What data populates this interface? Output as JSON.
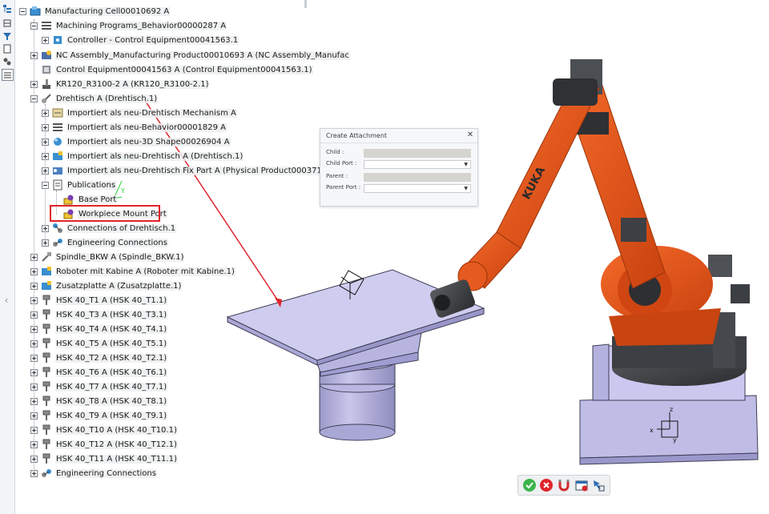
{
  "tree": {
    "items": [
      {
        "label": "Manufacturing Cell00010692 A",
        "icon": "manufacturing-cell-icon"
      },
      {
        "label": "Machining Programs_Behavior00000287 A",
        "icon": "behavior-icon"
      },
      {
        "label": "Controller - Control Equipment00041563.1",
        "icon": "controller-icon"
      },
      {
        "label": "NC Assembly_Manufacturing Product00010693 A (NC Assembly_Manufac",
        "icon": "nc-assembly-icon"
      },
      {
        "label": "Control Equipment00041563 A (Control Equipment00041563.1)",
        "icon": "control-equipment-icon"
      },
      {
        "label": "KR120_R3100-2 A (KR120_R3100-2.1)",
        "icon": "robot-icon"
      },
      {
        "label": "Drehtisch A (Drehtisch.1)",
        "icon": "turntable-icon"
      },
      {
        "label": "Importiert als neu-Drehtisch Mechanism A",
        "icon": "mechanism-icon"
      },
      {
        "label": "Importiert als neu-Behavior00001829 A",
        "icon": "behavior-icon"
      },
      {
        "label": "Importiert als neu-3D Shape00026904 A",
        "icon": "shape-icon"
      },
      {
        "label": "Importiert als neu-Drehtisch A (Drehtisch.1)",
        "icon": "product-icon"
      },
      {
        "label": "Importiert als neu-Drehtisch Fix Part A (Physical Product00037126.1)",
        "icon": "physical-product-icon"
      },
      {
        "label": "Publications",
        "icon": "publications-icon"
      },
      {
        "label": "Base Port",
        "icon": "port-icon"
      },
      {
        "label": "Workpiece Mount Port",
        "icon": "port-icon"
      },
      {
        "label": "Connections of Drehtisch.1",
        "icon": "connections-icon"
      },
      {
        "label": "Engineering Connections",
        "icon": "engineering-connections-icon"
      },
      {
        "label": "Spindle_BKW A (Spindle_BKW.1)",
        "icon": "spindle-icon"
      },
      {
        "label": "Roboter mit Kabine A (Roboter mit Kabine.1)",
        "icon": "product-icon"
      },
      {
        "label": "Zusatzplatte A (Zusatzplatte.1)",
        "icon": "product-icon"
      },
      {
        "label": "HSK 40_T1 A (HSK 40_T1.1)",
        "icon": "tool-icon"
      },
      {
        "label": "HSK 40_T3 A (HSK 40_T3.1)",
        "icon": "tool-icon"
      },
      {
        "label": "HSK 40_T4 A (HSK 40_T4.1)",
        "icon": "tool-icon"
      },
      {
        "label": "HSK 40_T5 A (HSK 40_T5.1)",
        "icon": "tool-icon"
      },
      {
        "label": "HSK 40_T2 A (HSK 40_T2.1)",
        "icon": "tool-icon"
      },
      {
        "label": "HSK 40_T6 A (HSK 40_T6.1)",
        "icon": "tool-icon"
      },
      {
        "label": "HSK 40_T7 A (HSK 40_T7.1)",
        "icon": "tool-icon"
      },
      {
        "label": "HSK 40_T8 A (HSK 40_T8.1)",
        "icon": "tool-icon"
      },
      {
        "label": "HSK 40_T9 A (HSK 40_T9.1)",
        "icon": "tool-icon"
      },
      {
        "label": "HSK 40_T10 A (HSK 40_T10.1)",
        "icon": "tool-icon"
      },
      {
        "label": "HSK 40_T12 A (HSK 40_T12.1)",
        "icon": "tool-icon"
      },
      {
        "label": "HSK 40_T11 A (HSK 40_T11.1)",
        "icon": "tool-icon"
      },
      {
        "label": "Engineering Connections",
        "icon": "engineering-connections-icon"
      }
    ],
    "selected": "Workpiece Mount Port"
  },
  "dialog": {
    "title": "Create Attachment",
    "close_icon": "close-icon",
    "child_label": "Child :",
    "child_port_label": "Child Port :",
    "parent_label": "Parent :",
    "parent_port_label": "Parent Port :",
    "child_value": "",
    "child_port_value": "",
    "parent_value": "",
    "parent_port_value": ""
  },
  "viewport": {
    "robot_brand": "KUKA",
    "axis_labels": {
      "x": "x",
      "y": "y",
      "z": "z"
    },
    "annotation_y": "Y"
  },
  "action_bar": {
    "buttons": [
      "ok-icon",
      "cancel-icon",
      "magnet-icon",
      "stop-snap-icon",
      "pick-icon"
    ]
  },
  "colors": {
    "accent_red": "#e0242b",
    "robot_orange": "#e0521c",
    "table_lavender": "#c7c5e8",
    "dialog_bg": "#f6f7f8"
  }
}
